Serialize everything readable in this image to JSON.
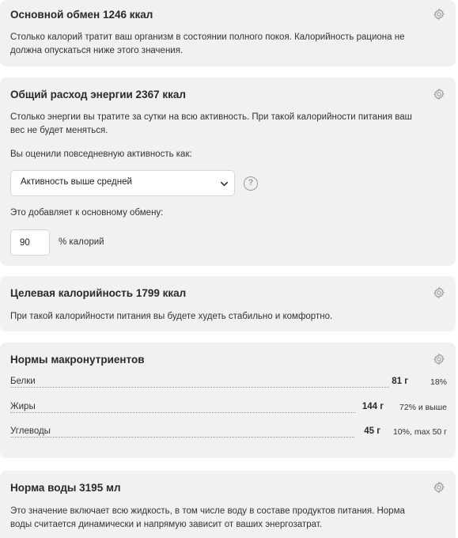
{
  "bmr": {
    "title": "Основной обмен 1246 ккал",
    "line1": "Столько калорий тратит ваш организм в состоянии полного покоя. Калорийность рациона не",
    "line2": "должна опускаться ниже этого значения.",
    "settings_icon": "gear-icon"
  },
  "tdee": {
    "title": "Общий расход энергии 2367 ккал",
    "line1": "Столько энергии вы тратите за сутки на всю активность. При такой калорийности питания ваш",
    "line2": "вес не будет меняться.",
    "activity_label": "Вы оценили повседневную активность как:",
    "activity_value": "Активность выше средней",
    "help_glyph": "?",
    "adds_label": "Это добавляет к основному обмену:",
    "percent_value": "90",
    "percent_unit": "% калорий",
    "settings_icon": "gear-icon"
  },
  "target": {
    "title": "Целевая калорийность 1799 ккал",
    "line1": "При такой калорийности питания вы будете худеть стабильно и комфортно.",
    "settings_icon": "gear-icon"
  },
  "macros": {
    "title": "Нормы макронутриентов",
    "settings_icon": "gear-icon",
    "rows": [
      {
        "name": "Белки",
        "grams": "81 г",
        "percent": "18%"
      },
      {
        "name": "Жиры",
        "grams": "144 г",
        "percent": "72% и выше"
      },
      {
        "name": "Углеводы",
        "grams": "45 г",
        "percent": "10%, max 50 г"
      }
    ]
  },
  "water": {
    "title": "Норма воды 3195 мл",
    "line1": "Это значение включает всю жидкость, в том числе воду в составе продуктов питания. Норма",
    "line2": "воды считается динамически и напрямую зависит от ваших энергозатрат.",
    "settings_icon": "gear-icon"
  },
  "colors": {
    "card_background": "#f1f1f2",
    "text": "#333333",
    "icon": "#9a9a9a"
  }
}
